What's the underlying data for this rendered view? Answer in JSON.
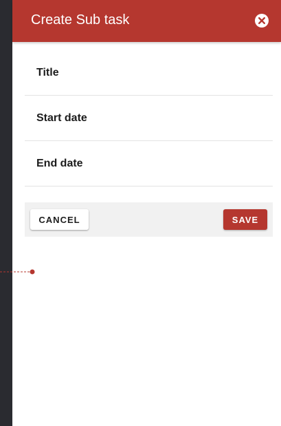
{
  "dialog": {
    "title": "Create Sub task",
    "close_icon": "close-circle-icon"
  },
  "fields": {
    "title_label": "Title",
    "start_date_label": "Start date",
    "end_date_label": "End date"
  },
  "actions": {
    "cancel_label": "CANCEL",
    "save_label": "SAVE"
  },
  "colors": {
    "accent": "#b5372f",
    "sidebar": "#2a2b30",
    "action_bar": "#f1f1f1"
  }
}
